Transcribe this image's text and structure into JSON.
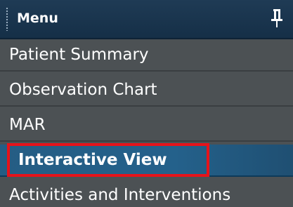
{
  "header": {
    "title": "Menu"
  },
  "menu": {
    "items": [
      {
        "label": "Patient Summary"
      },
      {
        "label": "Observation Chart"
      },
      {
        "label": "MAR"
      },
      {
        "label": "Interactive View"
      },
      {
        "label": "Activities and Interventions"
      }
    ],
    "selected_index": 3
  },
  "colors": {
    "header_bg": "#1a3650",
    "panel_bg": "#4c5154",
    "selected_bg": "#24618b",
    "annotation_box": "#e6131a"
  },
  "icons": {
    "pin": "pin-icon",
    "grip": "grip-handle-icon"
  }
}
